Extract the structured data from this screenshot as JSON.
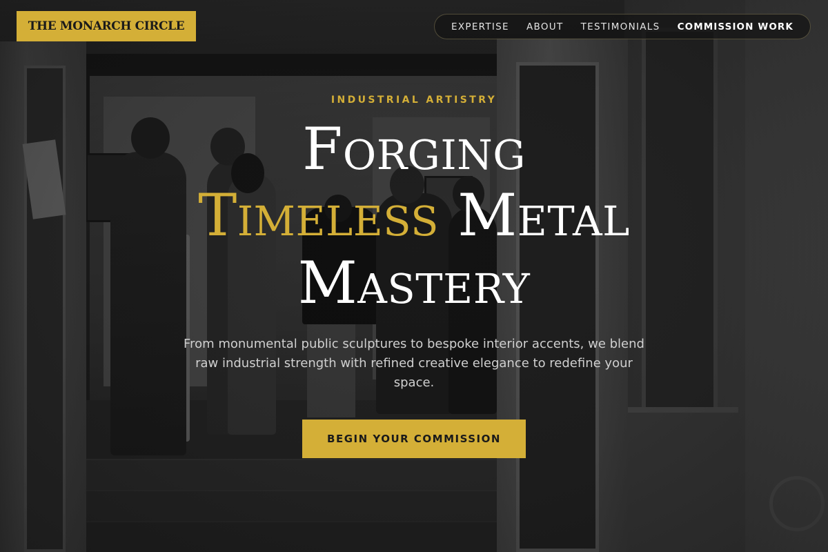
{
  "brand": {
    "name": "THE MONARCH CIRCLE",
    "accent_color": "#d4af37"
  },
  "nav": {
    "items": [
      {
        "label": "EXPERTISE"
      },
      {
        "label": "ABOUT"
      },
      {
        "label": "TESTIMONIALS"
      },
      {
        "label": "COMMISSION WORK",
        "active": true
      }
    ]
  },
  "hero": {
    "eyebrow": "INDUSTRIAL ARTISTRY",
    "headline": {
      "line1": "Forging",
      "line2_highlight": "Timeless",
      "line2_rest": " Metal",
      "line3": "Mastery"
    },
    "subtitle": "From monumental public sculptures to bespoke interior accents, we blend raw industrial strength with refined creative elegance to redefine your space.",
    "cta_label": "BEGIN YOUR COMMISSION",
    "background": "grayscale-gallery-photo"
  }
}
